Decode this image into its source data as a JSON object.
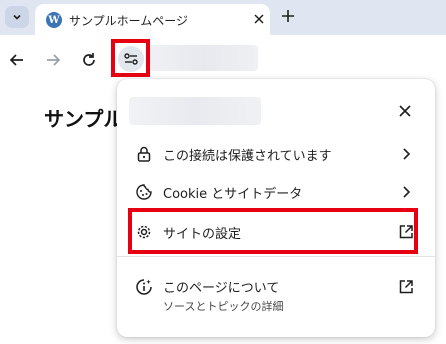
{
  "tab": {
    "title": "サンプルホームページ",
    "favicon": "wordpress-icon"
  },
  "page": {
    "heading": "サンプル"
  },
  "popup": {
    "items": [
      {
        "label": "この接続は保護されています",
        "icon": "lock-icon",
        "trail": "chevron-right-icon"
      },
      {
        "label": "Cookie とサイトデータ",
        "icon": "cookie-icon",
        "trail": "chevron-right-icon"
      },
      {
        "label": "サイトの設定",
        "icon": "gear-icon",
        "trail": "open-external-icon"
      }
    ],
    "about": {
      "label": "このページについて",
      "sublabel": "ソースとトピックの詳細",
      "icon": "page-info-icon"
    }
  },
  "colors": {
    "highlight": "#e60012",
    "tabstrip": "#dfe6f1"
  }
}
